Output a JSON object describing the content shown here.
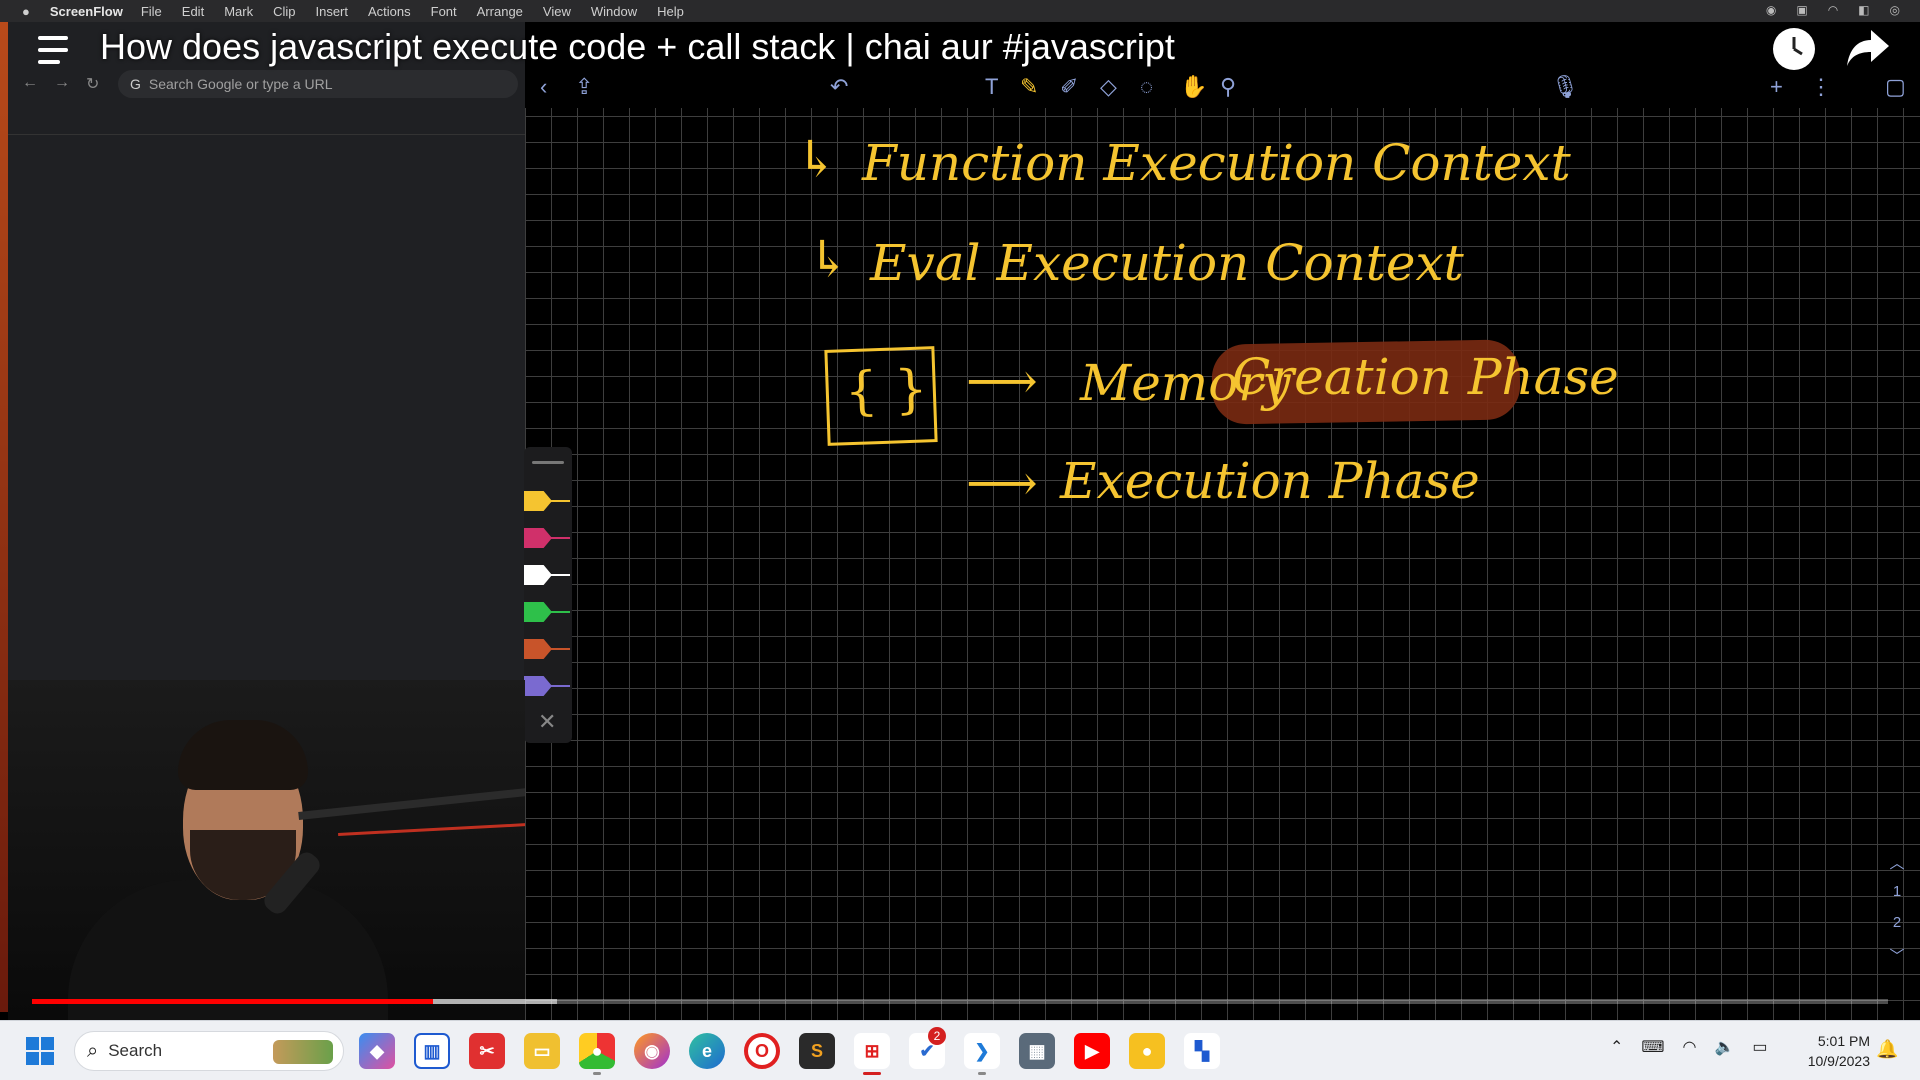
{
  "mac_menu": {
    "app_name": "ScreenFlow",
    "items": [
      "File",
      "Edit",
      "Mark",
      "Clip",
      "Insert",
      "Actions",
      "Font",
      "Arrange",
      "View",
      "Window",
      "Help"
    ]
  },
  "browser": {
    "url_placeholder": "Search Google or type a URL"
  },
  "video": {
    "title": "How does javascript execute code + call stack | chai aur #javascript",
    "progress_fraction": 0.216,
    "buffered_fraction": 0.283
  },
  "whiteboard": {
    "lines": [
      "Function Execution Context",
      "Eval Execution Context",
      "Memory",
      "Creation Phase",
      "Execution Phase"
    ],
    "brace_symbol": "{ }",
    "arrow_glyph": "↳",
    "right_arrow": "⟶",
    "ink_color": "#f5c430",
    "highlight_color": "#7a2a12",
    "pen_colors": [
      "#f5c430",
      "#d0306a",
      "#ffffff",
      "#2ec04a",
      "#c8542a",
      "#7a6ad0"
    ],
    "pager": {
      "page1": "1",
      "page2": "2"
    }
  },
  "taskbar": {
    "search_label": "Search",
    "badge_count": "2",
    "time": "5:01 PM",
    "date": "10/9/2023"
  },
  "colors": {
    "progress": "#ff0000",
    "taskbar_bg": "#eef0f4",
    "toolbar_icon": "#8fa2d8"
  }
}
